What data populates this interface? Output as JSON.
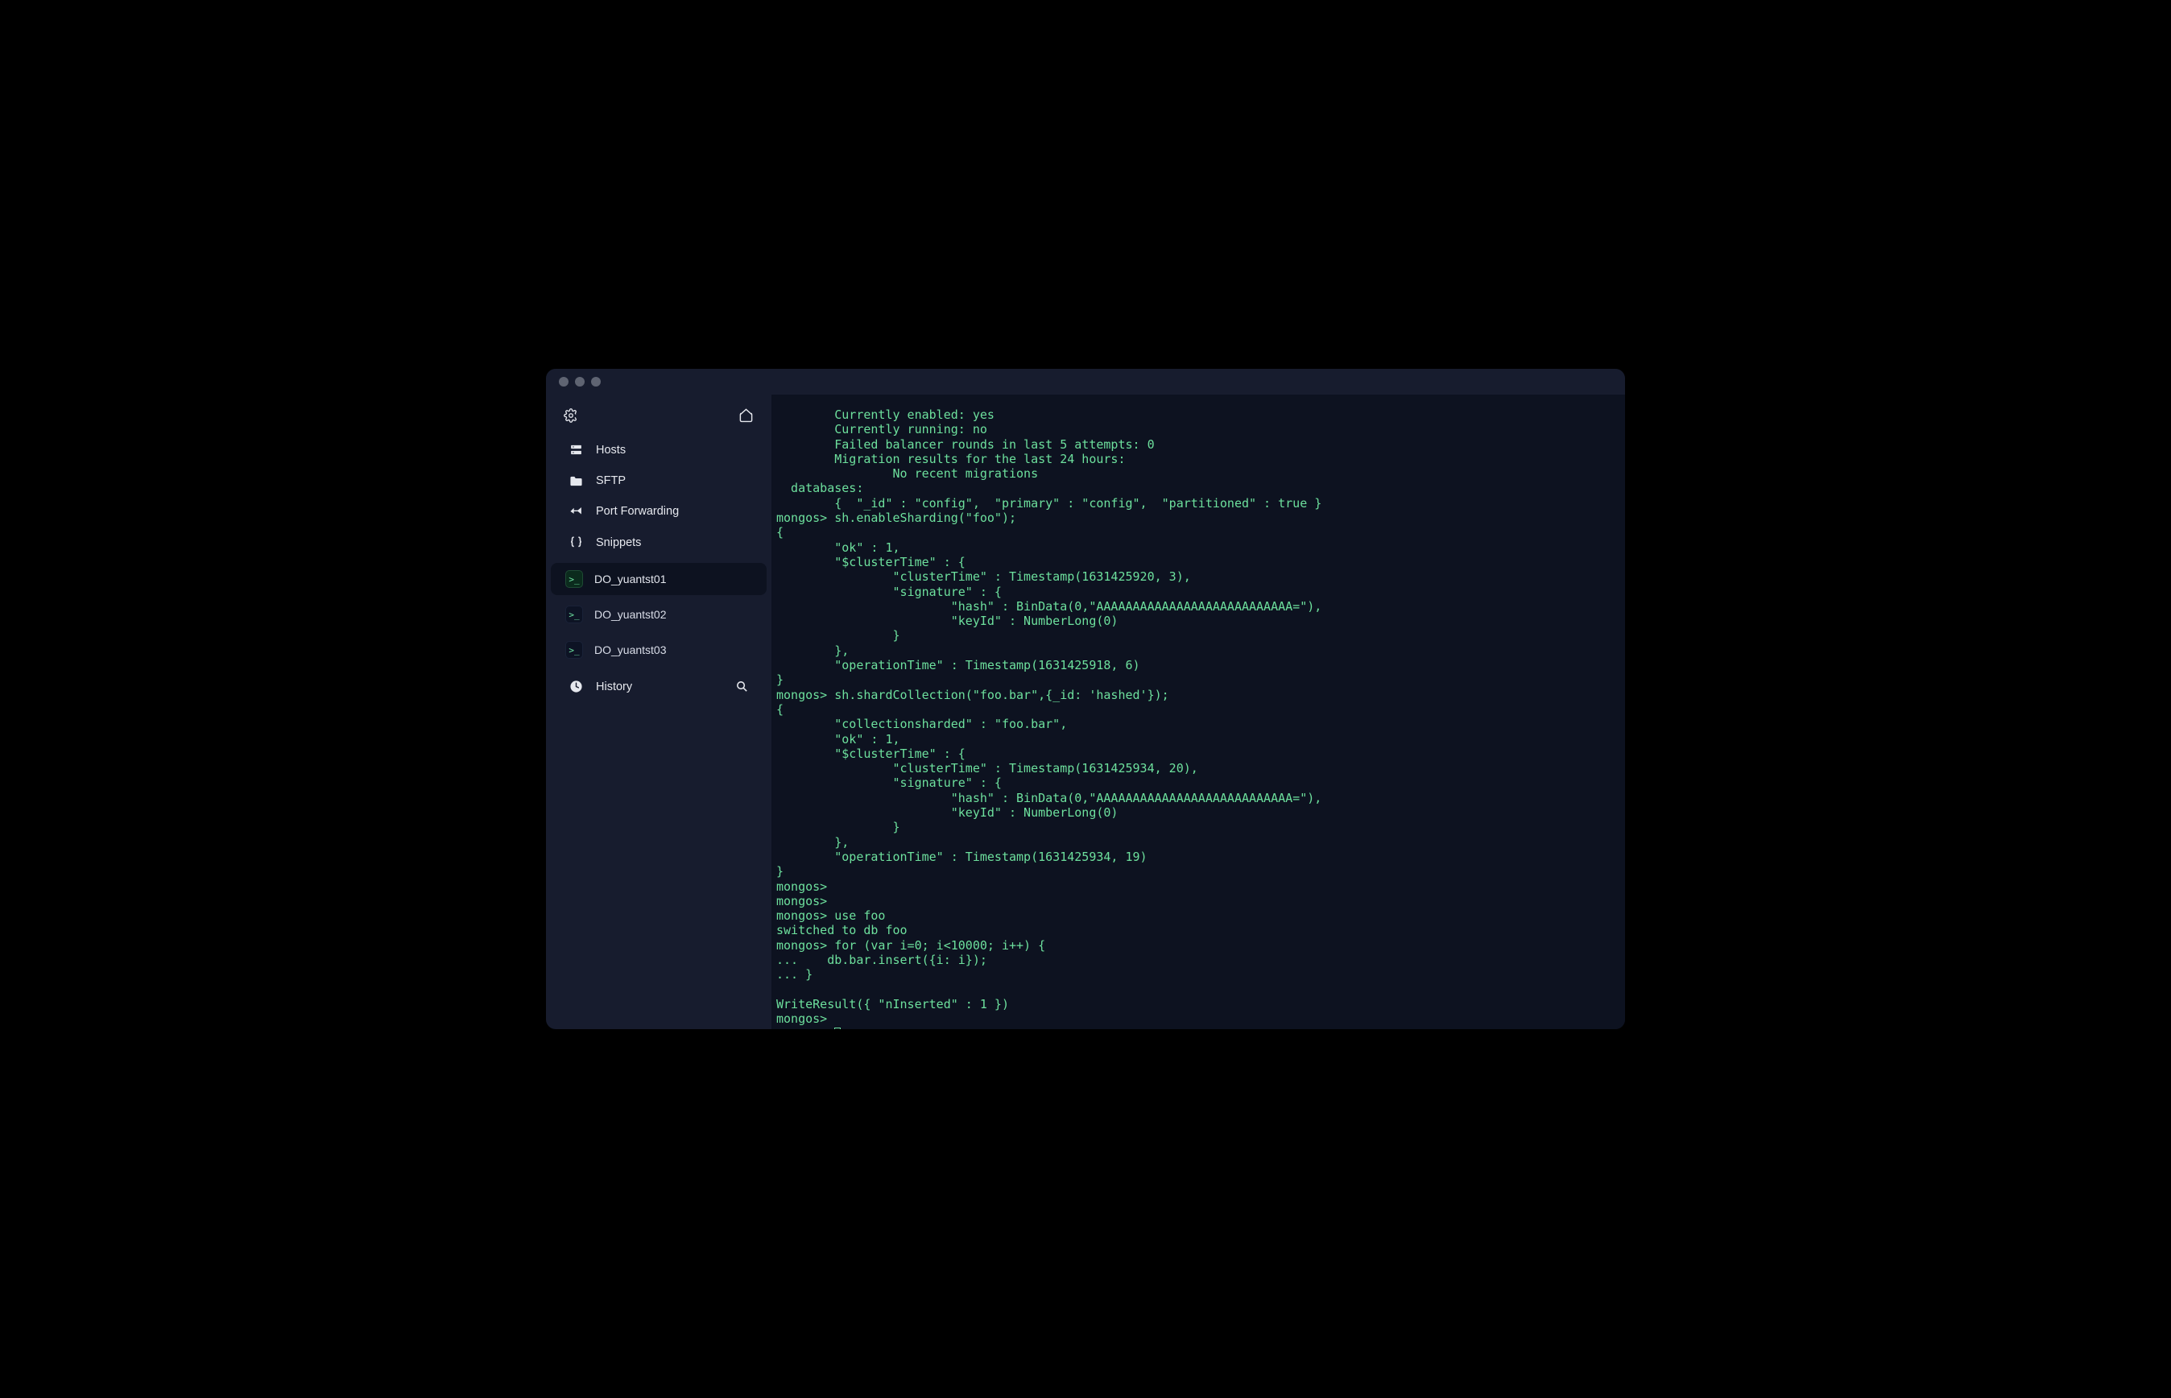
{
  "sidebar": {
    "nav": [
      {
        "label": "Hosts"
      },
      {
        "label": "SFTP"
      },
      {
        "label": "Port Forwarding"
      },
      {
        "label": "Snippets"
      }
    ],
    "tabs": [
      {
        "label": "DO_yuantst01",
        "active": true
      },
      {
        "label": "DO_yuantst02",
        "active": false
      },
      {
        "label": "DO_yuantst03",
        "active": false
      }
    ],
    "history_label": "History"
  },
  "terminal": {
    "lines": "        Currently enabled: yes\n        Currently running: no\n        Failed balancer rounds in last 5 attempts: 0\n        Migration results for the last 24 hours:\n                No recent migrations\n  databases:\n        {  \"_id\" : \"config\",  \"primary\" : \"config\",  \"partitioned\" : true }\nmongos> sh.enableSharding(\"foo\");\n{\n        \"ok\" : 1,\n        \"$clusterTime\" : {\n                \"clusterTime\" : Timestamp(1631425920, 3),\n                \"signature\" : {\n                        \"hash\" : BinData(0,\"AAAAAAAAAAAAAAAAAAAAAAAAAAA=\"),\n                        \"keyId\" : NumberLong(0)\n                }\n        },\n        \"operationTime\" : Timestamp(1631425918, 6)\n}\nmongos> sh.shardCollection(\"foo.bar\",{_id: 'hashed'});\n{\n        \"collectionsharded\" : \"foo.bar\",\n        \"ok\" : 1,\n        \"$clusterTime\" : {\n                \"clusterTime\" : Timestamp(1631425934, 20),\n                \"signature\" : {\n                        \"hash\" : BinData(0,\"AAAAAAAAAAAAAAAAAAAAAAAAAAA=\"),\n                        \"keyId\" : NumberLong(0)\n                }\n        },\n        \"operationTime\" : Timestamp(1631425934, 19)\n}\nmongos>\nmongos>\nmongos> use foo\nswitched to db foo\nmongos> for (var i=0; i<10000; i++) {\n...    db.bar.insert({i: i});\n... }\n\nWriteResult({ \"nInserted\" : 1 })\nmongos>\nmongos> "
  }
}
